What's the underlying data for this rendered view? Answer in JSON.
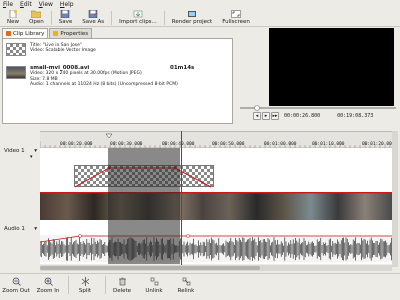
{
  "menu": [
    "File",
    "Edit",
    "View",
    "Help"
  ],
  "toolbar": {
    "new": "New",
    "open": "Open",
    "save": "Save",
    "save_as": "Save As",
    "import": "Import clips...",
    "render": "Render project",
    "fullscreen": "Fullscreen"
  },
  "tabs": {
    "library": "Clip Library",
    "properties": "Properties"
  },
  "clips": [
    {
      "title_line": "Title: \"Live in San Jose\"",
      "type": "Video: Scalable Vector Image"
    },
    {
      "name": "small-mvi_0008.avi",
      "duration": "01m14s",
      "video": "Video: 320 x 240 pixels at 30.00fps (Motion JPEG)",
      "size": "Size: 7.8 MB",
      "audio": "Audio: 1 channels at 11024 Hz (8 bits) (Uncompressed 8-bit PCM)"
    }
  ],
  "viewer": {
    "position": "00:00:26.800",
    "duration": "00:19:08.373"
  },
  "timeline": {
    "ticks": [
      "00:00:20.000",
      "00:00:30.000",
      "00:00:40.000",
      "00:00:50.000",
      "00:01:00.000",
      "00:01:10.000",
      "00:01:20.000"
    ],
    "video_track": "Video 1",
    "audio_track": "Audio 1"
  },
  "bottombar": {
    "zoom_out": "Zoom Out",
    "zoom_in": "Zoom In",
    "split": "Split",
    "delete": "Delete",
    "unlink": "Unlink",
    "relink": "Relink"
  },
  "colors": {
    "accent_red": "#d01818",
    "selection": "#333333",
    "waveform": "#111111"
  }
}
